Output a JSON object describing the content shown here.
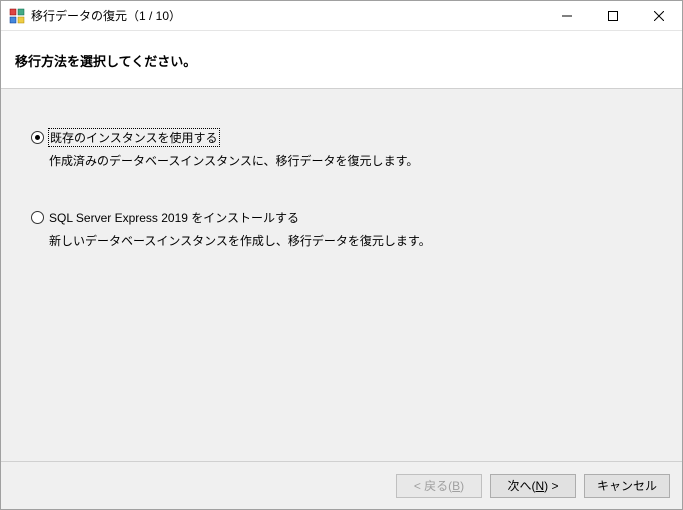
{
  "titlebar": {
    "title": "移行データの復元（1 / 10）"
  },
  "header": {
    "text": "移行方法を選択してください。"
  },
  "options": {
    "opt1": {
      "label": "既存のインスタンスを使用する",
      "desc": "作成済みのデータベースインスタンスに、移行データを復元します。",
      "selected": true
    },
    "opt2": {
      "label": "SQL Server Express 2019 をインストールする",
      "desc": "新しいデータベースインスタンスを作成し、移行データを復元します。",
      "selected": false
    }
  },
  "footer": {
    "back_prefix": "< 戻る(",
    "back_mnemonic": "B",
    "back_suffix": ")",
    "next_prefix": "次へ(",
    "next_mnemonic": "N",
    "next_suffix": ") >",
    "cancel": "キャンセル"
  }
}
